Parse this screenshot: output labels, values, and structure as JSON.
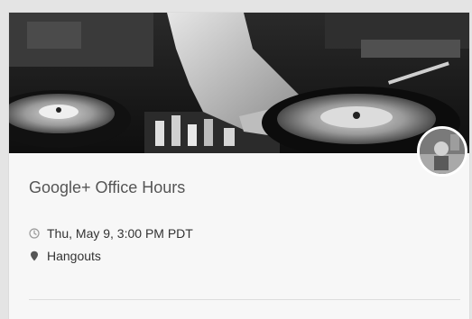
{
  "event": {
    "title": "Google+ Office Hours",
    "datetime": "Thu, May 9, 3:00 PM PDT",
    "location": "Hangouts",
    "cover_image": "dj-turntables-hand",
    "avatar_image": "host-profile-photo"
  },
  "icons": {
    "clock": "clock-icon",
    "location": "location-pin-icon"
  },
  "colors": {
    "card_background": "#f7f7f7",
    "title_text": "#555555",
    "body_text": "#333333",
    "icon_gray": "#9a9a9a"
  }
}
